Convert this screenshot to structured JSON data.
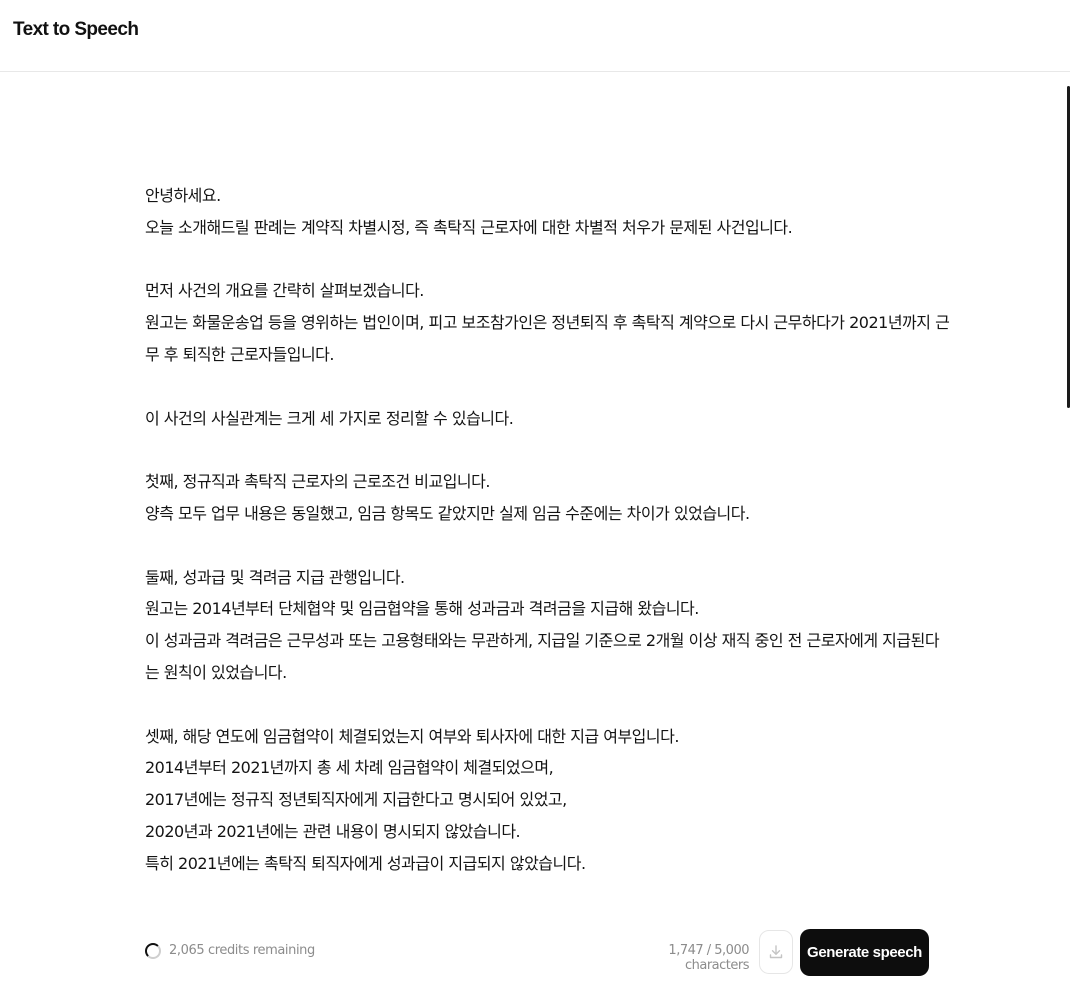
{
  "header": {
    "title": "Text to Speech"
  },
  "editor": {
    "lines": [
      "안녕하세요.",
      "오늘 소개해드릴 판례는 계약직 차별시정, 즉 촉탁직 근로자에 대한 차별적 처우가 문제된 사건입니다.",
      "",
      "먼저 사건의 개요를 간략히 살펴보겠습니다.",
      "원고는 화물운송업 등을 영위하는 법인이며, 피고 보조참가인은 정년퇴직 후 촉탁직 계약으로 다시 근무하다가 2021년까지 근",
      "무 후 퇴직한 근로자들입니다.",
      "",
      "이 사건의 사실관계는 크게 세 가지로 정리할 수 있습니다.",
      "",
      "첫째, 정규직과 촉탁직 근로자의 근로조건 비교입니다.",
      "양측 모두 업무 내용은 동일했고, 임금 항목도 같았지만 실제 임금 수준에는 차이가 있었습니다.",
      "",
      "둘째, 성과급 및 격려금 지급 관행입니다.",
      "원고는 2014년부터 단체협약 및 임금협약을 통해 성과금과 격려금을 지급해 왔습니다.",
      "이 성과금과 격려금은 근무성과 또는 고용형태와는 무관하게, 지급일 기준으로 2개월 이상 재직 중인 전 근로자에게 지급된다",
      "는 원칙이 있었습니다.",
      "",
      "셋째, 해당 연도에 임금협약이 체결되었는지 여부와 퇴사자에 대한 지급 여부입니다.",
      "2014년부터 2021년까지 총 세 차례 임금협약이 체결되었으며,",
      "2017년에는 정규직 정년퇴직자에게 지급한다고 명시되어 있었고,",
      "2020년과 2021년에는 관련 내용이 명시되지 않았습니다.",
      "특히 2021년에는 촉탁직 퇴직자에게 성과급이 지급되지 않았습니다."
    ]
  },
  "footer": {
    "credits_icon": "progress-ring-icon",
    "credits_text": "2,065 credits remaining",
    "character_count": "1,747 / 5,000 characters",
    "download_icon": "download-icon",
    "generate_label": "Generate speech"
  },
  "colors": {
    "primary_button": "#0d0d0d",
    "muted_text": "#8c8c8c",
    "border": "#e8e8e8"
  }
}
